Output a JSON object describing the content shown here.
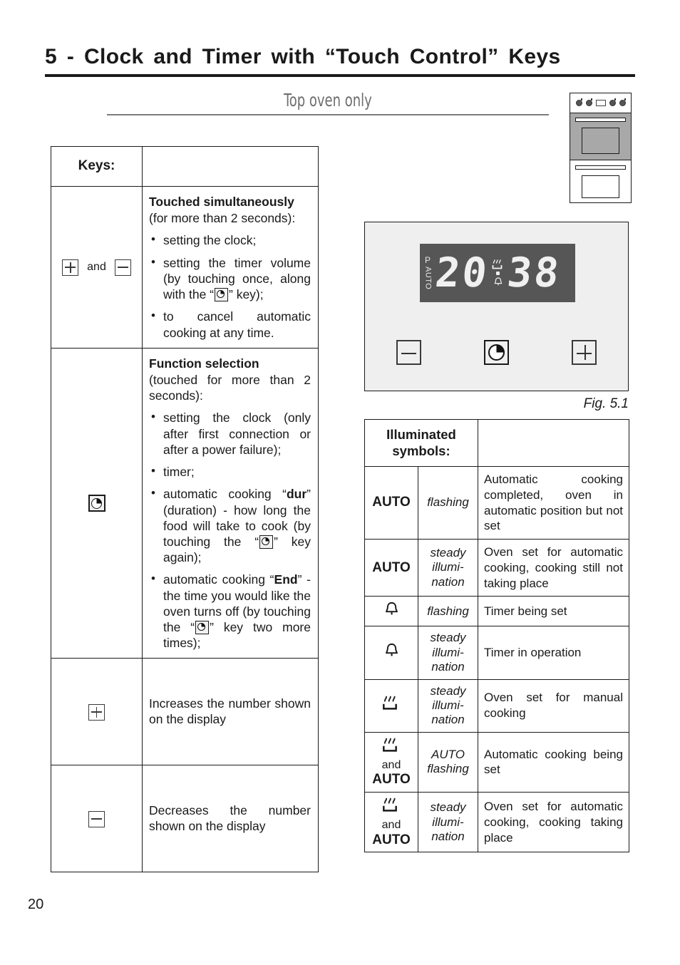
{
  "page": {
    "number": "20",
    "title": "5 - Clock and Timer with “Touch Control” Keys",
    "subtitle": "Top oven only"
  },
  "oven_thumbnail": {
    "name": "double-oven-top-highlighted"
  },
  "keys_table": {
    "header": {
      "col1": "Keys:",
      "col2": ""
    },
    "rows": [
      {
        "key_icons": [
          "plus-key",
          "minus-key"
        ],
        "key_joiner": "and",
        "heading": "Touched simultaneously",
        "subheading": "(for more than 2 seconds):",
        "bullets": [
          {
            "text_before": "setting the clock;",
            "icon": null,
            "text_after": ""
          },
          {
            "text_before": "setting the timer volume (by touching once, along with the “",
            "icon": "clock-key",
            "text_after": "” key);"
          },
          {
            "text_before": "to cancel automatic cooking at any time.",
            "icon": null,
            "text_after": ""
          }
        ]
      },
      {
        "key_icons": [
          "clock-key"
        ],
        "heading": "Function selection",
        "subheading": "(touched for more than 2 seconds):",
        "bullets": [
          {
            "text_before": "setting the clock (only after first connection or after a power failure);",
            "icon": null,
            "text_after": ""
          },
          {
            "text_before": "timer;",
            "icon": null,
            "text_after": ""
          },
          {
            "text_before": "automatic cooking “dur” (duration) - how long the food will take to cook (by touching the “",
            "icon": "clock-key",
            "text_after": "” key again);",
            "bold_word": "dur"
          },
          {
            "text_before": "automatic cooking “End” - the time you would like the oven turns off (by touching the “",
            "icon": "clock-key",
            "text_after": "” key two more times);",
            "bold_word": "End"
          }
        ]
      },
      {
        "key_icons": [
          "plus-key"
        ],
        "plain_text": "Increases the number shown on the display"
      },
      {
        "key_icons": [
          "minus-key"
        ],
        "plain_text": "Decreases the number shown on the display"
      }
    ],
    "row3_text": "Increases the number shown on the display",
    "row4_text": "Decreases the number shown on the display"
  },
  "figure": {
    "caption": "Fig. 5.1",
    "display": {
      "left_labels": {
        "p": "P",
        "auto": "AUTO"
      },
      "time": "20:38",
      "time_left": "20",
      "time_right": "38",
      "separator": ":",
      "mid_icons": [
        "heating-icon",
        "colon-dot",
        "bell-icon"
      ],
      "background_color": "#565656",
      "segment_color": "#f0f0f0"
    },
    "keys": [
      "minus-key",
      "clock-key",
      "plus-key"
    ],
    "panel_color": "#efefef"
  },
  "symbols_table": {
    "header": "Illuminated symbols:",
    "header_line1": "Illuminated",
    "header_line2": "symbols:",
    "rows": [
      {
        "symbol_text": "AUTO",
        "symbol_icon": null,
        "state": "flashing",
        "state_lines": [
          "flashing"
        ],
        "meaning": "Automatic cooking completed, oven in automatic position but not set"
      },
      {
        "symbol_text": "AUTO",
        "symbol_icon": null,
        "state": "steady illumination",
        "state_lines": [
          "steady",
          "illumi-",
          "nation"
        ],
        "meaning": "Oven set for automatic cooking, cooking still not taking place"
      },
      {
        "symbol_text": "",
        "symbol_icon": "bell-icon",
        "state": "flashing",
        "state_lines": [
          "flashing"
        ],
        "meaning": "Timer being set"
      },
      {
        "symbol_text": "",
        "symbol_icon": "bell-icon",
        "state": "steady illumination",
        "state_lines": [
          "steady",
          "illumi-",
          "nation"
        ],
        "meaning": "Timer in operation"
      },
      {
        "symbol_text": "",
        "symbol_icon": "heating-icon",
        "state": "steady illumination",
        "state_lines": [
          "steady",
          "illumi-",
          "nation"
        ],
        "meaning": "Oven set for manual cooking"
      },
      {
        "symbol_text": "AUTO",
        "symbol_icon": "heating-icon",
        "symbol_joiner": "and",
        "state": "AUTO flashing",
        "state_lines": [
          "AUTO",
          "flashing"
        ],
        "meaning": "Automatic cooking being set"
      },
      {
        "symbol_text": "AUTO",
        "symbol_icon": "heating-icon",
        "symbol_joiner": "and",
        "state": "steady illumination",
        "state_lines": [
          "steady",
          "illumi-",
          "nation"
        ],
        "meaning": "Oven set for automatic cooking, cooking taking place"
      }
    ]
  }
}
